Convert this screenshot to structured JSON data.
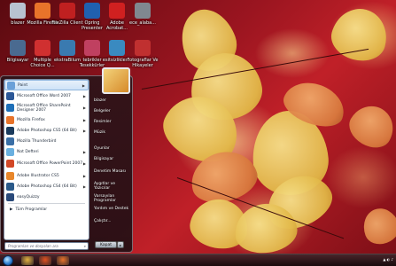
{
  "desktop_icons": [
    {
      "id": "blazer",
      "label": "blazer",
      "color": "#b8c2d0"
    },
    {
      "id": "firefox",
      "label": "Mozilla Firefox",
      "color": "#e8732a"
    },
    {
      "id": "filezilla",
      "label": "FileZilla Client",
      "color": "#c02020"
    },
    {
      "id": "opera",
      "label": "Opring Presenter",
      "color": "#2060b0"
    },
    {
      "id": "acrobat",
      "label": "Adobe Acrobat...",
      "color": "#d02020"
    },
    {
      "id": "file1",
      "label": "ece_alaba...",
      "color": "#808890"
    },
    {
      "id": "computer",
      "label": "Bilgisayar",
      "color": "#4a6a90"
    },
    {
      "id": "multiple",
      "label": "Multiple Choice Q...",
      "color": "#d03030"
    },
    {
      "id": "ekstra",
      "label": "ekstraBilum",
      "color": "#3a7ab0"
    },
    {
      "id": "tesekkur",
      "label": "tebrikler Tesekkürler",
      "color": "#c04060"
    },
    {
      "id": "esitsiz",
      "label": "esitsizlikler...",
      "color": "#3a8ac0"
    },
    {
      "id": "dosya",
      "label": "Fotograflar Ve Hikayeler",
      "color": "#c03030"
    }
  ],
  "start_menu": {
    "programs": [
      {
        "label": "Paint",
        "icon": "paint-icon",
        "color": "#6aa0d8",
        "arrow": true
      },
      {
        "label": "Microsoft Office Word 2007",
        "icon": "word-icon",
        "color": "#2b5797",
        "arrow": true
      },
      {
        "label": "Microsoft Office SharePoint Designer 2007",
        "icon": "sharepoint-icon",
        "color": "#1e6fb8",
        "arrow": true
      },
      {
        "label": "Mozilla Firefox",
        "icon": "firefox-icon",
        "color": "#e8732a",
        "arrow": true
      },
      {
        "label": "Adobe Photoshop CS5 (64 Bit)",
        "icon": "photoshop-icon",
        "color": "#1a3a5c",
        "arrow": true
      },
      {
        "label": "Mozilla Thunderbird",
        "icon": "thunderbird-icon",
        "color": "#3a6ea5",
        "arrow": false
      },
      {
        "label": "Not Defteri",
        "icon": "notepad-icon",
        "color": "#6ab0e0",
        "arrow": true
      },
      {
        "label": "Microsoft Office PowerPoint 2007",
        "icon": "powerpoint-icon",
        "color": "#d24726",
        "arrow": true
      },
      {
        "label": "Adobe Illustrator CS5",
        "icon": "illustrator-icon",
        "color": "#e8862a",
        "arrow": true
      },
      {
        "label": "Adobe Photoshop CS4 (64 Bit)",
        "icon": "photoshop-cs4-icon",
        "color": "#2a5a8a",
        "arrow": true
      },
      {
        "label": "easyQuizzy",
        "icon": "quiz-icon",
        "color": "#2a4a7a",
        "arrow": false
      }
    ],
    "all_programs": "Tüm Programlar",
    "search_placeholder": "Programları ve dosyaları ara",
    "right_items": [
      "blazer",
      "Belgeler",
      "Resimler",
      "Müzik",
      "Oyunlar",
      "Bilgisayar",
      "Denetim Masası",
      "Aygıtlar ve Yazıcılar",
      "Varsayılan Programlar",
      "Yardım ve Destek",
      "Çalıştır..."
    ],
    "shutdown_label": "Kapat"
  },
  "taskbar": {
    "pinned": [
      {
        "id": "explorer",
        "color": "#e0b040"
      },
      {
        "id": "media",
        "color": "#e05020"
      },
      {
        "id": "firefox",
        "color": "#e8732a"
      }
    ]
  }
}
